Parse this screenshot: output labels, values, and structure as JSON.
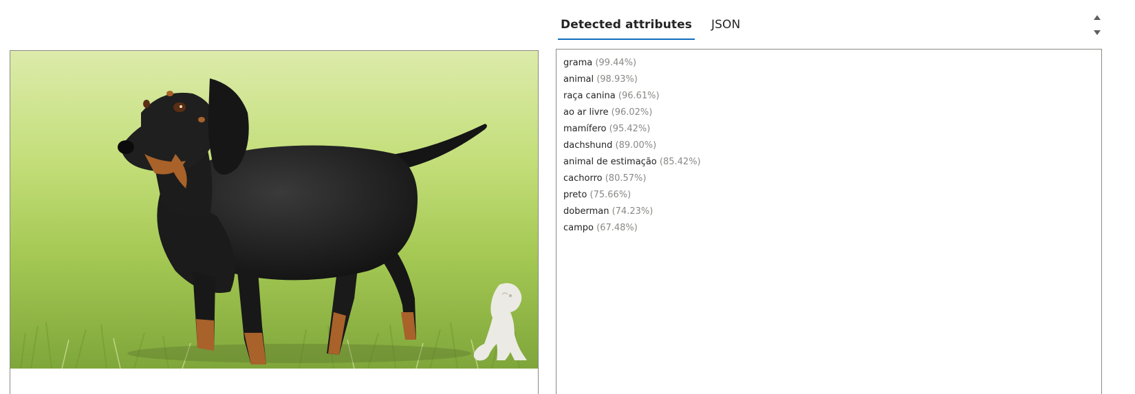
{
  "tabs": [
    {
      "label": "Detected attributes",
      "active": true
    },
    {
      "label": "JSON",
      "active": false
    }
  ],
  "image": {
    "subject": "dachshund-on-grass-photo",
    "watermark_icon": "sitting-dog-icon"
  },
  "attributes": [
    {
      "name": "grama",
      "confidence": "(99.44%)"
    },
    {
      "name": "animal",
      "confidence": "(98.93%)"
    },
    {
      "name": "raça canina",
      "confidence": "(96.61%)"
    },
    {
      "name": "ao ar livre",
      "confidence": "(96.02%)"
    },
    {
      "name": "mamífero",
      "confidence": "(95.42%)"
    },
    {
      "name": "dachshund",
      "confidence": "(89.00%)"
    },
    {
      "name": "animal de estimação",
      "confidence": "(85.42%)"
    },
    {
      "name": "cachorro",
      "confidence": "(80.57%)"
    },
    {
      "name": "preto",
      "confidence": "(75.66%)"
    },
    {
      "name": "doberman",
      "confidence": "(74.23%)"
    },
    {
      "name": "campo",
      "confidence": "(67.48%)"
    }
  ],
  "colors": {
    "accent": "#0f6cbd",
    "border": "#8a8886",
    "text": "#252423",
    "muted_text": "#8a8886"
  }
}
